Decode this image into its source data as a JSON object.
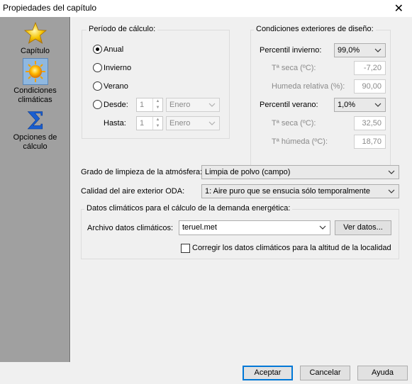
{
  "window": {
    "title": "Propiedades del capítulo",
    "close": "✕"
  },
  "sidebar": {
    "items": [
      {
        "label": "Capítulo",
        "icon": "star-icon"
      },
      {
        "label": "Condiciones climáticas",
        "icon": "sun-icon"
      },
      {
        "label": "Opciones de cálculo",
        "icon": "sigma-icon"
      }
    ]
  },
  "periodo": {
    "title": "Período de cálculo:",
    "options": [
      "Anual",
      "Invierno",
      "Verano",
      "Desde:"
    ],
    "selected": "Anual",
    "hasta_label": "Hasta:",
    "desde": {
      "day": "1",
      "month": "Enero"
    },
    "hasta": {
      "day": "1",
      "month": "Enero"
    }
  },
  "condiciones": {
    "title": "Condiciones exteriores de diseño:",
    "percentil_invierno_label": "Percentil invierno:",
    "percentil_invierno_value": "99,0%",
    "ts_invierno_label": "Tª seca (ºC):",
    "ts_invierno_value": "-7,20",
    "hr_label": "Humeda relativa (%):",
    "hr_value": "90,00",
    "percentil_verano_label": "Percentil verano:",
    "percentil_verano_value": "1,0%",
    "ts_verano_label": "Tª seca (ºC):",
    "ts_verano_value": "32,50",
    "th_label": "Tª húmeda (ºC):",
    "th_value": "18,70"
  },
  "grado_label": "Grado de limpieza de la atmósfera:",
  "grado_value": "Limpia de polvo (campo)",
  "calidad_label": "Calidad del aire exterior ODA:",
  "calidad_value": "1: Aire puro que se ensucia sólo temporalmente",
  "datos": {
    "title": "Datos climáticos para el cálculo de la demanda energética:",
    "archivo_label": "Archivo datos climáticos:",
    "archivo_value": "teruel.met",
    "ver_datos": "Ver datos...",
    "corregir_label": "Corregir los datos climáticos para la altitud de la localidad"
  },
  "buttons": {
    "aceptar": "Aceptar",
    "cancelar": "Cancelar",
    "ayuda": "Ayuda"
  },
  "spin_up": "▲",
  "spin_down": "▼"
}
